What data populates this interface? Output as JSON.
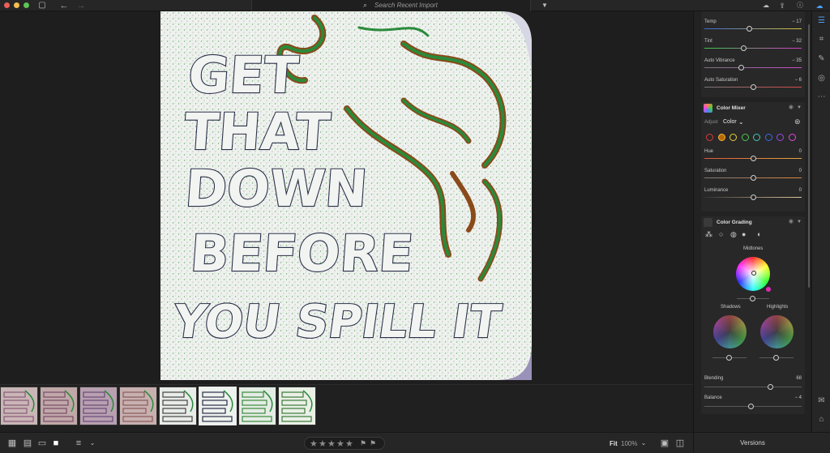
{
  "toolbar": {
    "search_placeholder": "Search Recent Import",
    "icons": [
      "sidebar-toggle-icon",
      "back-arrow-icon",
      "forward-arrow-icon",
      "search-icon",
      "filter-icon",
      "share-icon",
      "help-icon",
      "cloud-icon"
    ]
  },
  "photo": {
    "text_lines": [
      "GET",
      "THAT",
      "DOWN",
      "BEFORE",
      "YOU SPILL IT"
    ]
  },
  "filmstrip": {
    "count": 8,
    "selected_index": 5
  },
  "bottombar": {
    "rating_stars": 5,
    "fit_label": "Fit",
    "zoom_label": "100%",
    "versions_label": "Versions"
  },
  "edit_panel": {
    "color": {
      "sliders": [
        {
          "label": "Temp",
          "value": "− 17",
          "level": 0.46
        },
        {
          "label": "Tint",
          "value": "− 32",
          "level": 0.4
        },
        {
          "label": "Auto Vibrance",
          "value": "− 35",
          "level": 0.38
        },
        {
          "label": "Auto Saturation",
          "value": "− 6",
          "level": 0.5
        }
      ]
    },
    "color_mixer": {
      "title": "Color Mixer",
      "adjust_label": "Adjust",
      "adjust_value": "Color",
      "swatches": [
        "#e03a3a",
        "#ff9a2a",
        "#e8d23a",
        "#4cc94c",
        "#3ec9b8",
        "#3a6ae8",
        "#9a4ae8",
        "#e04ae0"
      ],
      "active_swatch": 1,
      "sliders": [
        {
          "label": "Hue",
          "value": "0",
          "level": 0.5
        },
        {
          "label": "Saturation",
          "value": "0",
          "level": 0.5
        },
        {
          "label": "Luminance",
          "value": "0",
          "level": 0.5
        }
      ]
    },
    "color_grading": {
      "title": "Color Grading",
      "midtones_label": "Midtones",
      "shadows_label": "Shadows",
      "highlights_label": "Highlights",
      "blending": {
        "label": "Blending",
        "value": "68",
        "level": 0.68
      },
      "balance": {
        "label": "Balance",
        "value": "− 4",
        "level": 0.48
      }
    }
  },
  "tools": [
    "edit-sliders-icon",
    "crop-icon",
    "healing-brush-icon",
    "masking-icon",
    "more-icon",
    "comment-icon",
    "tag-icon",
    "info-icon"
  ]
}
